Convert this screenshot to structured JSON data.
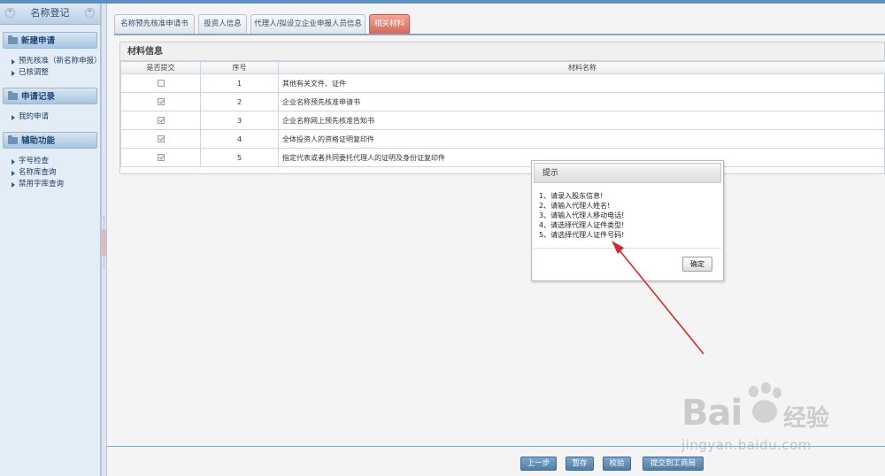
{
  "sidebar": {
    "title": "名称登记",
    "sections": [
      {
        "title": "新建申请",
        "items": [
          "预先核准（新名称申报）",
          "已核调整"
        ]
      },
      {
        "title": "申请记录",
        "items": [
          "我的申请"
        ]
      },
      {
        "title": "辅助功能",
        "items": [
          "字号检查",
          "名称库查询",
          "禁用字库查询"
        ]
      }
    ]
  },
  "tabs": [
    {
      "label": "名称预先核准申请书",
      "active": false
    },
    {
      "label": "投资人信息",
      "active": false
    },
    {
      "label": "代理人/拟设立企业申报人员信息",
      "active": false
    },
    {
      "label": "相关材料",
      "active": true
    }
  ],
  "materials": {
    "title": "材料信息",
    "columns": [
      "是否提交",
      "序号",
      "材料名称"
    ],
    "rows": [
      {
        "checked": false,
        "no": "1",
        "name": "其他有关文件、证件"
      },
      {
        "checked": true,
        "no": "2",
        "name": "企业名称预先核准申请书"
      },
      {
        "checked": true,
        "no": "3",
        "name": "企业名称网上预先核准告知书"
      },
      {
        "checked": true,
        "no": "4",
        "name": "全体投资人的资格证明复印件"
      },
      {
        "checked": true,
        "no": "5",
        "name": "指定代表或者共同委托代理人的证明及身份证复印件"
      }
    ]
  },
  "buttons": {
    "prev": "上一步",
    "save": "暂存",
    "check": "校验",
    "submit": "提交到工商局"
  },
  "dialog": {
    "title": "提示",
    "messages": [
      "1、请录入股东信息!",
      "2、请输入代理人姓名!",
      "3、请输入代理人移动电话!",
      "4、请选择代理人证件类型!",
      "5、请选择代理人证件号码!"
    ],
    "ok": "确定"
  },
  "watermark": {
    "brand": "Bai",
    "brand2": "经验",
    "url": "jingyan.baidu.com"
  },
  "colors": {
    "accent": "#5d8fbf",
    "active_tab": "#d9655a",
    "arrow": "#d42a2a"
  }
}
